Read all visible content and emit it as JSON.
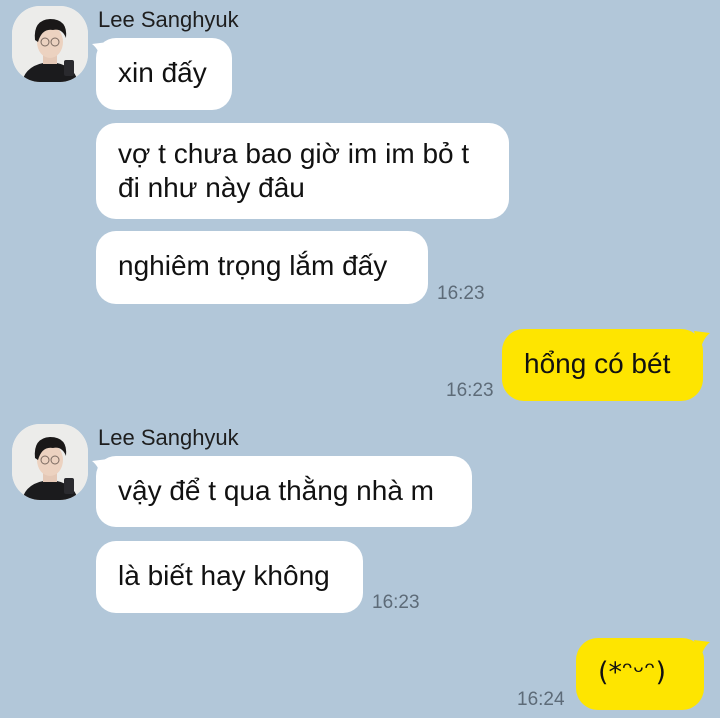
{
  "chat": {
    "contact_name": "Lee Sanghyuk",
    "groups": [
      {
        "sender": "Lee Sanghyuk",
        "messages": [
          {
            "text": "xin đấy"
          },
          {
            "line1": "vợ t chưa bao giờ im im bỏ t",
            "line2": "đi như này đâu"
          },
          {
            "text": "nghiêm trọng lắm đấy"
          }
        ],
        "time": "16:23"
      },
      {
        "direction": "outgoing",
        "messages": [
          {
            "text": "hổng có bét"
          }
        ],
        "time": "16:23"
      },
      {
        "sender": "Lee Sanghyuk",
        "messages": [
          {
            "text": "vậy để t qua thằng nhà m"
          },
          {
            "text": "là biết hay không"
          }
        ],
        "time": "16:23"
      },
      {
        "direction": "outgoing",
        "messages": [
          {
            "text": "(*ᵔᵕᵔ)"
          }
        ],
        "time": "16:24"
      }
    ]
  },
  "colors": {
    "background": "#b2c7d9",
    "incoming_bubble": "#ffffff",
    "outgoing_bubble": "#fee500",
    "timestamp": "#5d6b78"
  },
  "icons": {
    "avatar": "profile-photo-avatar"
  }
}
